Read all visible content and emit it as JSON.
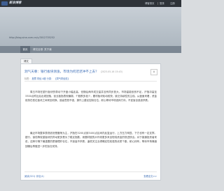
{
  "topbar": {
    "logo_text": "新浪博客",
    "links": {
      "home": "博客首页",
      "login": "登录",
      "register": "注册"
    }
  },
  "banner": {
    "url": "http://blog.sina.com.cn/u/3012735252"
  },
  "nav": {
    "items": [
      "首页",
      "博文目录",
      "关于我"
    ]
  },
  "board": {
    "tab_label": "博文"
  },
  "post": {
    "title": "洞气天尊：银行板块领涨，市场为何迟迟冲不上去？",
    "date": "(2023-05-16 15:43)",
    "font_button": "A",
    "meta": {
      "tags_label": "标签：",
      "tags": "股票 财经 A股 分类：",
      "category": "【洞气财经说】"
    },
    "paragraphs": [
      "周五市场在银行板块的带动下开盘小幅走高，但随后两市成交量并没有同步放大，市场量能依然不足，沪指冲高至3300点附近后出现回落，创业板指表现偏弱，个股跌多涨少，题材板块轮动较快，缺乏持续性的主线。从盘面来看，资金依然在低位板块之间来回切换，追高意愿不强，操作上建议控制仓位，耐心等待市场选择方向，不宜盲目追涨杀跌。",
      "最近市场整体表现依然是震荡为主，沪指在3200点到3400点区间内反复运行，上方压力明显，下方也有一定支撑。银行、保险等权重板块的异动更多是为了稳定指数，而题材股的炒作则更多来自短线资金的快进快出。对于普通投资者来说，这种行情下最重要的是管理好仓位，不追高不杀跌，逢低关注业绩确定性较强的优质个股，耐心持有，等待市场情绪回暖后再做进一步的加仓安排。"
    ],
    "footer": {
      "left": "阅读(321)  评论(4)",
      "right": "查看全文>>"
    }
  }
}
